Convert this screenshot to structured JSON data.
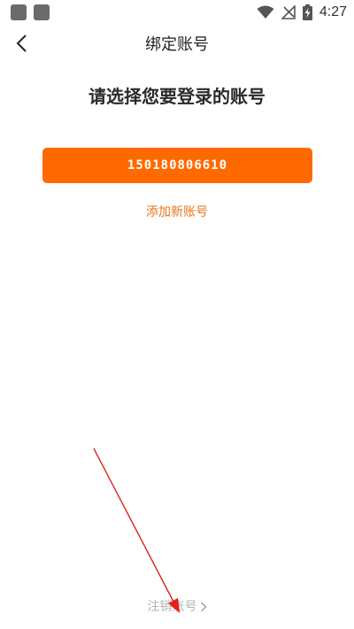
{
  "status_bar": {
    "time": "4:27",
    "icons": [
      "notification-square-icon",
      "notification-square-icon",
      "wifi-icon",
      "no-signal-icon",
      "battery-charging-icon"
    ]
  },
  "header": {
    "title": "绑定账号",
    "back_icon": "chevron-left-icon"
  },
  "main": {
    "heading": "请选择您要登录的账号",
    "account_number": "150180806610",
    "add_account_label": "添加新账号",
    "cancel_account_label": "注销账号",
    "cancel_icon": "chevron-right-icon"
  },
  "colors": {
    "accent": "#ff6a00",
    "link": "#e8761a",
    "muted": "#b3b3b3",
    "annotation": "#e0201a"
  }
}
